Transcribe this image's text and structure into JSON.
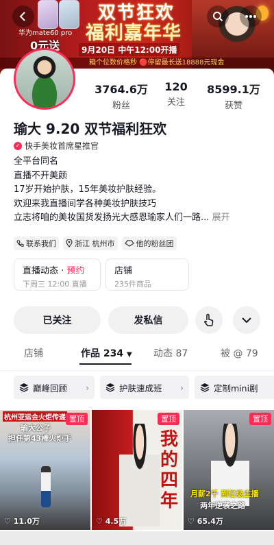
{
  "banner": {
    "promo_line1": "华为mate60 pro",
    "promo_line2": "0元送",
    "title_line1": "双节狂欢",
    "title_line2": "福利嘉年华",
    "date": "9月20日 中午12:00开播",
    "ticker": "箱个位数价格秒  🔴停留最长送18888元现金"
  },
  "profile": {
    "stats": [
      {
        "value": "3764.6万",
        "label": "粉丝"
      },
      {
        "value": "120",
        "label": "关注"
      },
      {
        "value": "8599.1万",
        "label": "获赞"
      }
    ],
    "name": "瑜大 9.20 双节福利狂欢",
    "verified": "快手美妆首席星推官",
    "bio": [
      "全平台同名",
      "直播不开美颜",
      "17岁开始护肤，15年美妆护肤经验。",
      "欢迎来我直播间学各种美妆护肤技巧",
      "立志将咱的美妆国货发扬光大感恩瑜家人们一路..."
    ],
    "bio_more": "展开",
    "tags": [
      "联系我们",
      "浙江 杭州市",
      "他的粉丝团"
    ]
  },
  "cards": [
    {
      "title": "直播动态 · ",
      "accent": "预约",
      "sub": "下周三 12:00 直播"
    },
    {
      "title": "店铺",
      "accent": "",
      "sub": "235件商品"
    }
  ],
  "actions": {
    "followed": "已关注",
    "message": "发私信"
  },
  "tabs": [
    {
      "label": "店铺"
    },
    {
      "label": "作品 234"
    },
    {
      "label": "动态 87"
    },
    {
      "label": "被 @ 79"
    }
  ],
  "chips": [
    "巅峰回顾",
    "护肤速成班",
    "定制mini剧"
  ],
  "videos": [
    {
      "pin": "置顶",
      "likes": "11.0万",
      "caption1": "杭州亚运会火炬传递",
      "caption2": "瑜大公子",
      "caption3": "担任第43棒火炬手"
    },
    {
      "pin": "置顶",
      "likes": "4.5万",
      "caption1": "我的四年"
    },
    {
      "pin": "置顶",
      "likes": "65.4万",
      "caption1": "月薪2千 到亿级主播",
      "caption2": "两年逆袭之路"
    }
  ]
}
